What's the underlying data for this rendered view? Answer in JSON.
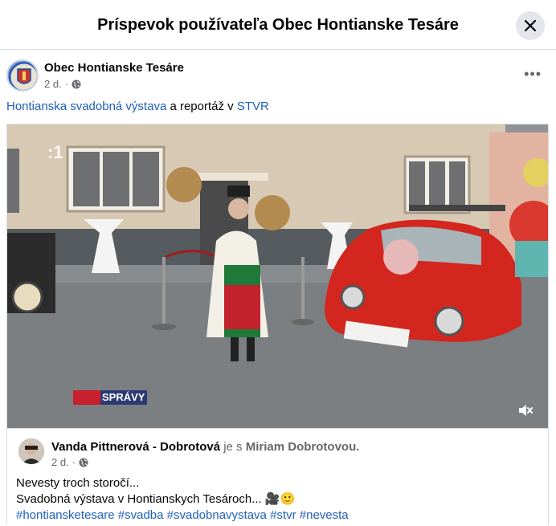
{
  "header": {
    "title": "Príspevok používateľa Obec Hontianske Tesáre",
    "close_icon": "close-icon"
  },
  "post": {
    "author": "Obec Hontianske Tesáre",
    "time": "2 d.",
    "separator": "·",
    "privacy_icon": "globe-icon",
    "more_label": "•••",
    "text": {
      "link1": "Hontianska svadobná výstava",
      "middle": " a reportáž v ",
      "link2": "STVR"
    }
  },
  "video": {
    "tv_logo": ":1",
    "badge": "SPRÁVY",
    "mute_icon": "speaker-muted-icon"
  },
  "shared_post": {
    "author": "Vanda Pittnerová - Dobrotová",
    "with_text": " je s ",
    "with_person": "Miriam Dobrotovou.",
    "time": "2 d.",
    "separator": "·",
    "line1": "Nevesty troch storočí...",
    "line2": "Svadobná výstava v Hontianskych Tesároch... 🎥🙂",
    "hashtags": [
      "#hontiansketesare",
      "#svadba",
      "#svadobnavystava",
      "#stvr",
      "#nevesta"
    ]
  }
}
